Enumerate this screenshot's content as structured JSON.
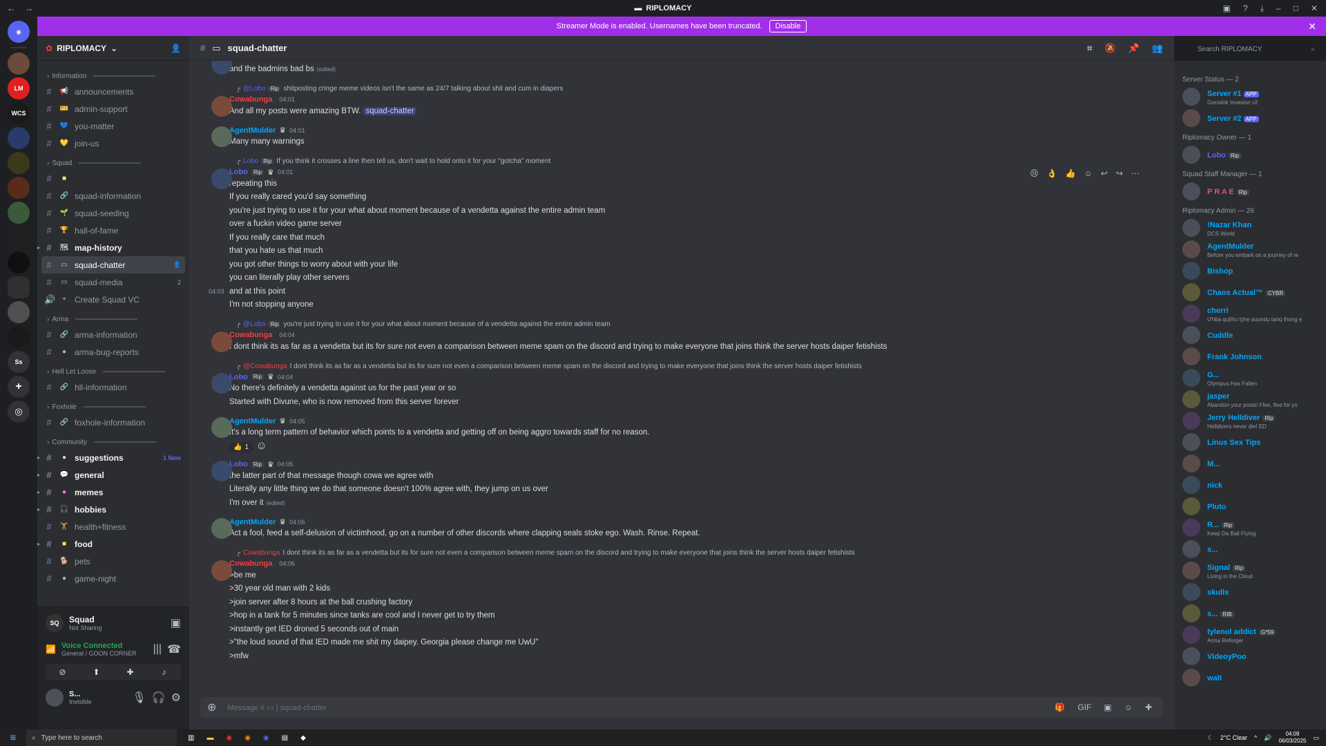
{
  "window": {
    "title": "RIPLOMACY"
  },
  "banner": {
    "text": "Streamer Mode is enabled. Usernames have been truncated.",
    "button": "Disable"
  },
  "rail": [
    "LM",
    "WCS",
    "Ss"
  ],
  "guild": {
    "name": "RIPLOMACY"
  },
  "channels": [
    {
      "type": "cat",
      "label": "Information"
    },
    {
      "type": "ch",
      "label": "announcements",
      "emo": "📢",
      "color": "#ed4245"
    },
    {
      "type": "ch",
      "label": "admin-support",
      "emo": "🎫",
      "color": "#5865f2"
    },
    {
      "type": "ch",
      "label": "you-matter",
      "emo": "💙",
      "color": "#3b82f6"
    },
    {
      "type": "ch",
      "label": "join-us",
      "emo": "💛",
      "color": "#fee75c"
    },
    {
      "type": "cat",
      "label": "Squad"
    },
    {
      "type": "ch",
      "label": "",
      "emo": "■",
      "color": "#fee75c"
    },
    {
      "type": "ch",
      "label": "squad-information",
      "emo": "🔗",
      "color": "#b5bac1"
    },
    {
      "type": "ch",
      "label": "squad-seeding",
      "emo": "🌱",
      "color": "#fee75c"
    },
    {
      "type": "ch",
      "label": "hall-of-fame",
      "emo": "🏆",
      "color": "#fee75c"
    },
    {
      "type": "ch",
      "label": "map-history",
      "emo": "🗺",
      "color": "#b5bac1",
      "bold": true,
      "arrow": true
    },
    {
      "type": "ch",
      "label": "squad-chatter",
      "emo": "▭",
      "color": "#b5bac1",
      "active": true
    },
    {
      "type": "ch",
      "label": "squad-media",
      "emo": "▭",
      "color": "#b5bac1",
      "right": "2"
    },
    {
      "type": "ch",
      "label": "Create Squad VC",
      "emo": "+",
      "color": "#b5bac1",
      "voice": true
    },
    {
      "type": "cat",
      "label": "Arma"
    },
    {
      "type": "ch",
      "label": "arma-information",
      "emo": "🔗",
      "color": "#b5bac1"
    },
    {
      "type": "ch",
      "label": "arma-bug-reports",
      "emo": "●",
      "color": "#b5bac1"
    },
    {
      "type": "cat",
      "label": "Hell Let Loose"
    },
    {
      "type": "ch",
      "label": "hll-information",
      "emo": "🔗",
      "color": "#b5bac1"
    },
    {
      "type": "cat",
      "label": "Foxhole"
    },
    {
      "type": "ch",
      "label": "foxhole-information",
      "emo": "🔗",
      "color": "#b5bac1"
    },
    {
      "type": "cat",
      "label": "Community"
    },
    {
      "type": "ch",
      "label": "suggestions",
      "emo": "●",
      "color": "#dbdee1",
      "bold": true,
      "arrow": true,
      "new": "1 New"
    },
    {
      "type": "ch",
      "label": "general",
      "emo": "💬",
      "color": "#dbdee1",
      "bold": true,
      "arrow": true
    },
    {
      "type": "ch",
      "label": "memes",
      "emo": "●",
      "color": "#f47fff",
      "bold": true,
      "arrow": true
    },
    {
      "type": "ch",
      "label": "hobbies",
      "emo": "🎧",
      "color": "#dbdee1",
      "bold": true,
      "arrow": true
    },
    {
      "type": "ch",
      "label": "health+fitness",
      "emo": "🏋",
      "color": "#fee75c"
    },
    {
      "type": "ch",
      "label": "food",
      "emo": "■",
      "color": "#fee75c",
      "bold": true,
      "arrow": true
    },
    {
      "type": "ch",
      "label": "pets",
      "emo": "🐕",
      "color": "#fee75c"
    },
    {
      "type": "ch",
      "label": "game-night",
      "emo": "●",
      "color": "#b5bac1"
    }
  ],
  "voice": {
    "channel": "Squad",
    "sharing": "Not Sharing",
    "status": "Voice Connected",
    "location": "General / GOON CORNER",
    "user": "S...",
    "user_status": "Invisible"
  },
  "header": {
    "channel": "squad-chatter"
  },
  "search": {
    "placeholder": "Search RIPLOMACY"
  },
  "messages": [
    {
      "cont": true,
      "name": "Lobo",
      "color": "#5865f2",
      "tag": "Rip",
      "time": "04:01",
      "lines": [
        "and the badmins bad bs"
      ],
      "edited": "(edited)"
    },
    {
      "reply": {
        "name": "@Lobo",
        "tag": "Rip",
        "text": "shitposting cringe meme videos isn't the same as 24/7 talking about shit and cum in diapers"
      },
      "name": "Cowabunga",
      "color": "#f23f43",
      "time": "04:01",
      "lines": [
        "And all my posts were amazing BTW."
      ],
      "mention": "squad-chatter"
    },
    {
      "name": "AgentMulder",
      "color": "#00a8fc",
      "time": "04:01",
      "lines": [
        "Many many warnings"
      ]
    },
    {
      "reply": {
        "name": "Lobo",
        "tag": "Rip",
        "text": "If you think it crosses a line then tell us, don't wait to hold onto it for your \"gotcha\" moment"
      },
      "name": "Lobo",
      "color": "#5865f2",
      "tag": "Rip",
      "time": "04:01",
      "lines": [
        "repeating this",
        "If you really cared you'd say something",
        "you're just trying to use it for your what about moment because of a vendetta against the entire admin team",
        "over a fuckin video game server",
        "If you really care that much",
        "that you hate us that much",
        "you got other things to worry about with your life",
        "you can literally play other servers",
        "and at this point",
        "I'm not stopping anyone"
      ],
      "sidetime": "04:03"
    },
    {
      "reply": {
        "name": "@Lobo",
        "tag": "Rip",
        "text": "you're just trying to use it for your what about moment because of a vendetta against the entire admin team"
      },
      "name": "Cowabunga",
      "color": "#f23f43",
      "time": "04:04",
      "lines": [
        "I dont think its as far as a vendetta but its for sure not even a comparison between meme spam on the discord and trying to make everyone that joins think the server hosts daiper fetishists"
      ]
    },
    {
      "reply": {
        "name": "@Cowabunga",
        "red": true,
        "text": "I dont think its as far as a vendetta but its for sure not even a comparison between meme spam on the discord and trying to make everyone that joins think the server hosts daiper fetishists"
      },
      "name": "Lobo",
      "color": "#5865f2",
      "tag": "Rip",
      "time": "04:04",
      "lines": [
        "No there's definitely a vendetta against us for the past year or so",
        "Started with Divune, who is now removed from this server forever"
      ]
    },
    {
      "name": "AgentMulder",
      "color": "#00a8fc",
      "time": "04:05",
      "lines": [
        "It's a long term pattern of behavior which points to a vendetta and getting off on being aggro towards staff for no reason."
      ],
      "reaction": {
        "emoji": "👍",
        "count": "1"
      }
    },
    {
      "name": "Lobo",
      "color": "#5865f2",
      "tag": "Rip",
      "time": "04:05",
      "lines": [
        "the latter part of that message though cowa we agree with",
        "Literally any little thing we do that someone doesn't 100% agree with, they jump on us over",
        "I'm over it"
      ],
      "edited": "(edited)"
    },
    {
      "name": "AgentMulder",
      "color": "#00a8fc",
      "time": "04:06",
      "lines": [
        "Act a fool, feed a self-delusion of victimhood, go on a number of other discords where clapping seals stoke ego. Wash. Rinse. Repeat."
      ]
    },
    {
      "reply": {
        "name": "Cowabunga",
        "red": true,
        "text": "I dont think its as far as a vendetta but its for sure not even a comparison between meme spam on the discord and trying to make everyone that joins think the server hosts daiper fetishists"
      },
      "name": "Cowabunga",
      "color": "#f23f43",
      "time": "04:06",
      "lines": [
        ">be me",
        ">30 year old man with 2 kids",
        ">join server after 8 hours at the ball crushing factory",
        ">hop in a tank for 5 minutes since tanks are cool and I never get to try them",
        ">instantly get IED droned 5 seconds out of main",
        ">\"the loud sound of that IED made me shit my daipey. Georgia please change me UwU\"",
        ">mfw"
      ]
    }
  ],
  "composer": {
    "placeholder": "Message #",
    "channel": "squad-chatter"
  },
  "member_groups": [
    {
      "label": "Server Status — 2",
      "members": [
        {
          "name": "Server #1",
          "color": "#00a8fc",
          "status": "Gorodok Invasion v2",
          "app": "APP"
        },
        {
          "name": "Server #2",
          "color": "#00a8fc",
          "status": "",
          "app": "APP"
        }
      ]
    },
    {
      "label": "Riplomacy Owner — 1",
      "members": [
        {
          "name": "Lobo",
          "color": "#5865f2",
          "tag": "Rip"
        }
      ]
    },
    {
      "label": "Squad Staff Manager — 1",
      "members": [
        {
          "name": "P R A E",
          "color": "#eb459e",
          "tag": "Rip"
        }
      ]
    },
    {
      "label": "Riplomacy Admin — 26",
      "members": [
        {
          "name": "!Nazar Khan",
          "color": "#00a8fc",
          "status": "DCS World"
        },
        {
          "name": "AgentMulder",
          "color": "#00a8fc",
          "status": "Before you embark on a journey of re"
        },
        {
          "name": "Bishop",
          "color": "#00a8fc"
        },
        {
          "name": "Chaos Actual™",
          "color": "#00a8fc",
          "tag": "CYBR"
        },
        {
          "name": "cherri",
          "color": "#00a8fc",
          "status": "Ưhbạ quỹhu tỳhẹ ạuụndụ tạnq thọng ẹ"
        },
        {
          "name": "Cuddle",
          "color": "#00a8fc"
        },
        {
          "name": "Frank Johnson",
          "color": "#00a8fc"
        },
        {
          "name": "G...",
          "color": "#00a8fc",
          "status": "Olympus Has Fallen"
        },
        {
          "name": "jasper",
          "color": "#00a8fc",
          "status": "Abandon your posts! Flee, flee for yo"
        },
        {
          "name": "Jerry Helldiver",
          "color": "#00a8fc",
          "tag": "Rip",
          "status": "Helldivers never die! ED"
        },
        {
          "name": "Linus Sex Tips",
          "color": "#00a8fc"
        },
        {
          "name": "M...",
          "color": "#00a8fc"
        },
        {
          "name": "nick",
          "color": "#00a8fc"
        },
        {
          "name": "Pluto",
          "color": "#00a8fc"
        },
        {
          "name": "R...",
          "color": "#00a8fc",
          "tag": "Rip",
          "status": "Keep Da Ball Flying"
        },
        {
          "name": "s...",
          "color": "#00a8fc"
        },
        {
          "name": "Signal",
          "color": "#00a8fc",
          "tag": "Rip",
          "status": "Living in the Cloud"
        },
        {
          "name": "skulls",
          "color": "#00a8fc"
        },
        {
          "name": "s...",
          "color": "#00a8fc",
          "tag": "RIB"
        },
        {
          "name": "tylenol addict",
          "color": "#00a8fc",
          "tag": "G*59",
          "status": "Arma Reforger"
        },
        {
          "name": "VideoyPoo",
          "color": "#00a8fc"
        },
        {
          "name": "walt",
          "color": "#00a8fc"
        }
      ]
    }
  ],
  "taskbar": {
    "search": "Type here to search",
    "weather": "2°C Clear",
    "time": "04:09",
    "date": "06/03/2025"
  }
}
